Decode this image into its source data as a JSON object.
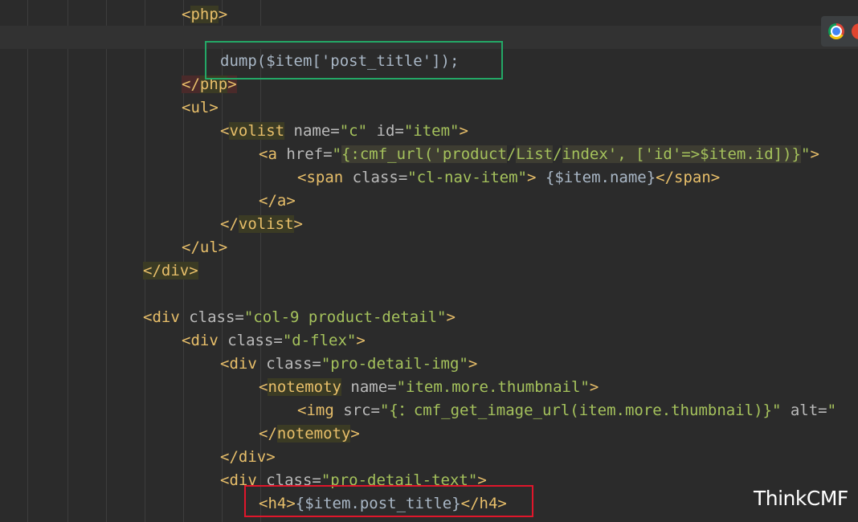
{
  "editor": {
    "lines": [
      {
        "tokens": [
          {
            "t": "<",
            "c": "tag"
          },
          {
            "t": "php",
            "c": "taghl"
          },
          {
            "t": ">",
            "c": "tag"
          }
        ]
      },
      {
        "tokens": []
      },
      {
        "tokens": [
          {
            "t": "dump($item['post_title']);",
            "c": "plain"
          }
        ]
      },
      {
        "tokens": [
          {
            "t": "</",
            "c": "phphl"
          },
          {
            "t": "php",
            "c": "taghl"
          },
          {
            "t": ">",
            "c": "phphl"
          }
        ]
      },
      {
        "tokens": [
          {
            "t": "<ul>",
            "c": "tag"
          }
        ]
      },
      {
        "tokens": [
          {
            "t": "<",
            "c": "tag"
          },
          {
            "t": "volist",
            "c": "taghl"
          },
          {
            "t": " name=",
            "c": "attr"
          },
          {
            "t": "\"c\"",
            "c": "str"
          },
          {
            "t": " id=",
            "c": "attr"
          },
          {
            "t": "\"item\"",
            "c": "str"
          },
          {
            "t": ">",
            "c": "tag"
          }
        ]
      },
      {
        "tokens": [
          {
            "t": "<a",
            "c": "tag"
          },
          {
            "t": " href=",
            "c": "attr"
          },
          {
            "t": "\"",
            "c": "str"
          },
          {
            "t": "{:cmf_url('product",
            "c": "tplhl"
          },
          {
            "t": "/",
            "c": "str"
          },
          {
            "t": "List",
            "c": "tplhl"
          },
          {
            "t": "/",
            "c": "str"
          },
          {
            "t": "index', ['id'=>$item.id])}",
            "c": "tplhl"
          },
          {
            "t": "\"",
            "c": "str"
          },
          {
            "t": ">",
            "c": "tag"
          }
        ]
      },
      {
        "tokens": [
          {
            "t": "<span",
            "c": "tag"
          },
          {
            "t": " class=",
            "c": "attr"
          },
          {
            "t": "\"cl-nav-item\"",
            "c": "str"
          },
          {
            "t": ">",
            "c": "tag"
          },
          {
            "t": " {$item.name}",
            "c": "plain"
          },
          {
            "t": "</span>",
            "c": "tag"
          }
        ]
      },
      {
        "tokens": [
          {
            "t": "</a>",
            "c": "tag"
          }
        ]
      },
      {
        "tokens": [
          {
            "t": "</",
            "c": "tag"
          },
          {
            "t": "volist",
            "c": "taghl"
          },
          {
            "t": ">",
            "c": "tag"
          }
        ]
      },
      {
        "tokens": [
          {
            "t": "</ul>",
            "c": "tag"
          }
        ]
      },
      {
        "tokens": [
          {
            "t": "</div>",
            "c": "taghl"
          }
        ]
      },
      {
        "tokens": []
      },
      {
        "tokens": [
          {
            "t": "<div",
            "c": "tag"
          },
          {
            "t": " class=",
            "c": "attr"
          },
          {
            "t": "\"col-9 product-detail\"",
            "c": "str"
          },
          {
            "t": ">",
            "c": "tag"
          }
        ]
      },
      {
        "tokens": [
          {
            "t": "<div",
            "c": "tag"
          },
          {
            "t": " class=",
            "c": "attr"
          },
          {
            "t": "\"d-flex\"",
            "c": "str"
          },
          {
            "t": ">",
            "c": "tag"
          }
        ]
      },
      {
        "tokens": [
          {
            "t": "<div",
            "c": "tag"
          },
          {
            "t": " class=",
            "c": "attr"
          },
          {
            "t": "\"pro-detail-img\"",
            "c": "str"
          },
          {
            "t": ">",
            "c": "tag"
          }
        ]
      },
      {
        "tokens": [
          {
            "t": "<",
            "c": "tag"
          },
          {
            "t": "notemoty",
            "c": "taghl"
          },
          {
            "t": " name=",
            "c": "attr"
          },
          {
            "t": "\"item.more.thumbnail\"",
            "c": "str"
          },
          {
            "t": ">",
            "c": "tag"
          }
        ]
      },
      {
        "tokens": [
          {
            "t": "<img",
            "c": "tag"
          },
          {
            "t": " src=",
            "c": "attr"
          },
          {
            "t": "\"{：cmf_get_image_url(item.more.thumbnail)}\"",
            "c": "str"
          },
          {
            "t": " alt=",
            "c": "attr"
          },
          {
            "t": "\"",
            "c": "str"
          }
        ]
      },
      {
        "tokens": [
          {
            "t": "</",
            "c": "tag"
          },
          {
            "t": "notemoty",
            "c": "taghl"
          },
          {
            "t": ">",
            "c": "tag"
          }
        ]
      },
      {
        "tokens": [
          {
            "t": "</div>",
            "c": "tag"
          }
        ]
      },
      {
        "tokens": [
          {
            "t": "<div",
            "c": "tag"
          },
          {
            "t": " class=",
            "c": "attr"
          },
          {
            "t": "\"pro-detail-text\"",
            "c": "str"
          },
          {
            "t": ">",
            "c": "tag"
          }
        ]
      },
      {
        "tokens": [
          {
            "t": "<h4>",
            "c": "tag"
          },
          {
            "t": "{$item.post_title}",
            "c": "plain"
          },
          {
            "t": "</h4>",
            "c": "tag"
          }
        ]
      }
    ]
  },
  "watermark": "ThinkCMF",
  "annotation_colors": {
    "green_box": "#23a866",
    "red_box": "#e0162b"
  },
  "icons": [
    "chrome-icon",
    "opera-icon"
  ]
}
